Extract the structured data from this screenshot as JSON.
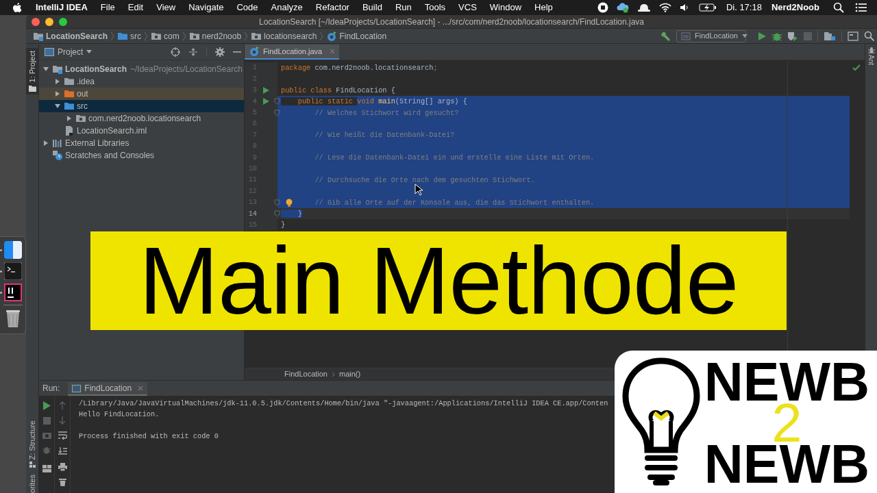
{
  "menubar": {
    "app": "IntelliJ IDEA",
    "menus": [
      "File",
      "Edit",
      "View",
      "Navigate",
      "Code",
      "Analyze",
      "Refactor",
      "Build",
      "Run",
      "Tools",
      "VCS",
      "Window",
      "Help"
    ],
    "clock": "Di. 17:18",
    "user": "Nerd2Noob"
  },
  "window": {
    "title": "LocationSearch [~/IdeaProjects/LocationSearch] - .../src/com/nerd2noob/locationsearch/FindLocation.java"
  },
  "breadcrumbs": [
    {
      "label": "LocationSearch",
      "kind": "module"
    },
    {
      "label": "src",
      "kind": "source-folder"
    },
    {
      "label": "com",
      "kind": "package"
    },
    {
      "label": "nerd2noob",
      "kind": "package"
    },
    {
      "label": "locationsearch",
      "kind": "package"
    },
    {
      "label": "FindLocation",
      "kind": "class"
    }
  ],
  "toolbar": {
    "run_config": "FindLocation"
  },
  "project_panel": {
    "stripe_tab": {
      "label": "1: Project",
      "selected": true
    },
    "title": "Project",
    "tree": [
      {
        "label": "LocationSearch",
        "hint": "~/IdeaProjects/LocationSearch",
        "kind": "module",
        "expanded": true,
        "selected": false,
        "children": [
          {
            "label": ".idea",
            "kind": "folder",
            "expanded": false,
            "selected": false
          },
          {
            "label": "out",
            "kind": "excluded-folder",
            "expanded": false,
            "selected": false
          },
          {
            "label": "src",
            "kind": "source-folder",
            "expanded": true,
            "selected": true,
            "children": [
              {
                "label": "com.nerd2noob.locationsearch",
                "kind": "package",
                "expanded": false,
                "selected": false
              }
            ]
          },
          {
            "label": "LocationSearch.iml",
            "kind": "file",
            "selected": false
          }
        ]
      },
      {
        "label": "External Libraries",
        "kind": "libraries",
        "expanded": false,
        "selected": false
      },
      {
        "label": "Scratches and Consoles",
        "kind": "scratches",
        "selected": false
      }
    ]
  },
  "editor": {
    "tab": "FindLocation.java",
    "lines": [
      {
        "number": "1",
        "selected": false,
        "current": false,
        "segments": [
          {
            "text": "package ",
            "kind": "keyword"
          },
          {
            "text": "com.nerd2noob.locationsearch",
            "kind": "plain"
          },
          {
            "text": ";",
            "kind": "keyword"
          }
        ]
      },
      {
        "number": "2"
      },
      {
        "number": "3",
        "selected": false,
        "current": false,
        "run_marker": true,
        "segments": [
          {
            "text": "public class ",
            "kind": "keyword"
          },
          {
            "text": "FindLocation {",
            "kind": "plain"
          }
        ]
      },
      {
        "number": "4",
        "selected": true,
        "current": false,
        "run_marker": true,
        "fold": true,
        "segments": [
          {
            "text": "    public static ",
            "kind": "keyword",
            "selected": false
          },
          {
            "text": "void ",
            "kind": "keyword",
            "selected": true
          },
          {
            "text": "main",
            "kind": "method",
            "selected": true
          },
          {
            "text": "(String[] args) {",
            "kind": "plain",
            "selected": true
          }
        ]
      },
      {
        "number": "5",
        "selected": true,
        "current": false,
        "fold": true,
        "segments": [
          {
            "text": "        // Welches Stichwort wird gesucht?",
            "kind": "comment"
          }
        ]
      },
      {
        "number": "6",
        "selected": true,
        "current": false
      },
      {
        "number": "7",
        "selected": true,
        "current": false,
        "segments": [
          {
            "text": "        // Wie heißt die Datenbank-Datei?",
            "kind": "comment"
          }
        ]
      },
      {
        "number": "8",
        "selected": true,
        "current": false
      },
      {
        "number": "9",
        "selected": true,
        "current": false,
        "segments": [
          {
            "text": "        // Lese die Datenbank-Datei ein und erstelle eine Liste mit Orten.",
            "kind": "comment"
          }
        ]
      },
      {
        "number": "10",
        "selected": true,
        "current": false
      },
      {
        "number": "11",
        "selected": true,
        "current": false,
        "segments": [
          {
            "text": "        // Durchsuche die Orte nach dem gesuchten Stichwort.",
            "kind": "comment"
          }
        ]
      },
      {
        "number": "12",
        "selected": true,
        "current": false
      },
      {
        "number": "13",
        "selected": true,
        "current": false,
        "bulb": true,
        "fold": true,
        "segments": [
          {
            "text": "        // Gib alle Orte auf der Konsole aus, die das Stichwort enthalten.",
            "kind": "comment"
          }
        ]
      },
      {
        "number": "14",
        "selected": false,
        "current": true,
        "fold": true,
        "segments": [
          {
            "text": "    }",
            "kind": "plain",
            "selected": true
          }
        ]
      },
      {
        "number": "15",
        "selected": false,
        "current": false,
        "segments": [
          {
            "text": "}",
            "kind": "plain"
          }
        ]
      }
    ],
    "breadcrumb": [
      "FindLocation",
      "main()"
    ]
  },
  "right_stripe": {
    "label": "Ant",
    "selected": false
  },
  "left_stripe": [
    {
      "label": "Z: Structure",
      "selected": false
    },
    {
      "label": "orites",
      "selected": false
    }
  ],
  "run_panel": {
    "label": "Run:",
    "tab": "FindLocation",
    "console": [
      {
        "text": "/Library/Java/JavaVirtualMachines/jdk-11.0.5.jdk/Contents/Home/bin/java \"-javaagent:/Applications/IntelliJ IDEA CE.app/Conten",
        "kind": "command"
      },
      {
        "text": "Hello FindLocation.",
        "kind": "output"
      },
      {
        "text": "Process finished with exit code 0",
        "kind": "status"
      }
    ]
  },
  "banner": "Main Methode",
  "logo": {
    "top": "NEWB",
    "middle": "2",
    "bottom": "NEWB"
  }
}
